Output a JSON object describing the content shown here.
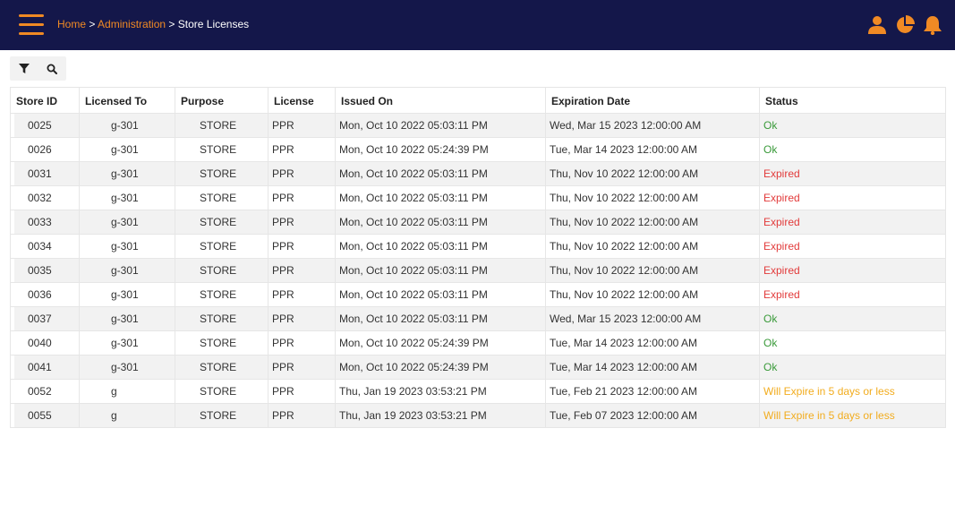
{
  "breadcrumb": {
    "home": "Home",
    "sep1": " > ",
    "admin": "Administration",
    "sep2": " > ",
    "current": "Store Licenses"
  },
  "header_icons": [
    "user-icon",
    "pie-chart-icon",
    "bell-icon"
  ],
  "toolbar": [
    "filter-icon",
    "search-icon"
  ],
  "colors": {
    "topbar": "#14174a",
    "accent": "#f08a24",
    "ok": "#3a9a3a",
    "expired": "#e23b3b",
    "warn": "#f2ac1e"
  },
  "table": {
    "columns": [
      "Store ID",
      "Licensed To",
      "Purpose",
      "License",
      "Issued On",
      "Expiration Date",
      "Status"
    ],
    "rows": [
      {
        "store_id": "0025",
        "licensed_to": "g-301",
        "purpose": "STORE",
        "license": "PPR",
        "issued_on": "Mon, Oct 10 2022 05:03:11 PM",
        "expiration": "Wed, Mar 15 2023 12:00:00 AM",
        "status": "Ok",
        "status_type": "ok"
      },
      {
        "store_id": "0026",
        "licensed_to": "g-301",
        "purpose": "STORE",
        "license": "PPR",
        "issued_on": "Mon, Oct 10 2022 05:24:39 PM",
        "expiration": "Tue, Mar 14 2023 12:00:00 AM",
        "status": "Ok",
        "status_type": "ok"
      },
      {
        "store_id": "0031",
        "licensed_to": "g-301",
        "purpose": "STORE",
        "license": "PPR",
        "issued_on": "Mon, Oct 10 2022 05:03:11 PM",
        "expiration": "Thu, Nov 10 2022 12:00:00 AM",
        "status": "Expired",
        "status_type": "expired"
      },
      {
        "store_id": "0032",
        "licensed_to": "g-301",
        "purpose": "STORE",
        "license": "PPR",
        "issued_on": "Mon, Oct 10 2022 05:03:11 PM",
        "expiration": "Thu, Nov 10 2022 12:00:00 AM",
        "status": "Expired",
        "status_type": "expired"
      },
      {
        "store_id": "0033",
        "licensed_to": "g-301",
        "purpose": "STORE",
        "license": "PPR",
        "issued_on": "Mon, Oct 10 2022 05:03:11 PM",
        "expiration": "Thu, Nov 10 2022 12:00:00 AM",
        "status": "Expired",
        "status_type": "expired"
      },
      {
        "store_id": "0034",
        "licensed_to": "g-301",
        "purpose": "STORE",
        "license": "PPR",
        "issued_on": "Mon, Oct 10 2022 05:03:11 PM",
        "expiration": "Thu, Nov 10 2022 12:00:00 AM",
        "status": "Expired",
        "status_type": "expired"
      },
      {
        "store_id": "0035",
        "licensed_to": "g-301",
        "purpose": "STORE",
        "license": "PPR",
        "issued_on": "Mon, Oct 10 2022 05:03:11 PM",
        "expiration": "Thu, Nov 10 2022 12:00:00 AM",
        "status": "Expired",
        "status_type": "expired"
      },
      {
        "store_id": "0036",
        "licensed_to": "g-301",
        "purpose": "STORE",
        "license": "PPR",
        "issued_on": "Mon, Oct 10 2022 05:03:11 PM",
        "expiration": "Thu, Nov 10 2022 12:00:00 AM",
        "status": "Expired",
        "status_type": "expired"
      },
      {
        "store_id": "0037",
        "licensed_to": "g-301",
        "purpose": "STORE",
        "license": "PPR",
        "issued_on": "Mon, Oct 10 2022 05:03:11 PM",
        "expiration": "Wed, Mar 15 2023 12:00:00 AM",
        "status": "Ok",
        "status_type": "ok"
      },
      {
        "store_id": "0040",
        "licensed_to": "g-301",
        "purpose": "STORE",
        "license": "PPR",
        "issued_on": "Mon, Oct 10 2022 05:24:39 PM",
        "expiration": "Tue, Mar 14 2023 12:00:00 AM",
        "status": "Ok",
        "status_type": "ok"
      },
      {
        "store_id": "0041",
        "licensed_to": "g-301",
        "purpose": "STORE",
        "license": "PPR",
        "issued_on": "Mon, Oct 10 2022 05:24:39 PM",
        "expiration": "Tue, Mar 14 2023 12:00:00 AM",
        "status": "Ok",
        "status_type": "ok"
      },
      {
        "store_id": "0052",
        "licensed_to": "g",
        "purpose": "STORE",
        "license": "PPR",
        "issued_on": "Thu, Jan 19 2023 03:53:21 PM",
        "expiration": "Tue, Feb 21 2023 12:00:00 AM",
        "status": "Will Expire in 5 days or less",
        "status_type": "warn"
      },
      {
        "store_id": "0055",
        "licensed_to": "g",
        "purpose": "STORE",
        "license": "PPR",
        "issued_on": "Thu, Jan 19 2023 03:53:21 PM",
        "expiration": "Tue, Feb 07 2023 12:00:00 AM",
        "status": "Will Expire in 5 days or less",
        "status_type": "warn"
      }
    ]
  }
}
